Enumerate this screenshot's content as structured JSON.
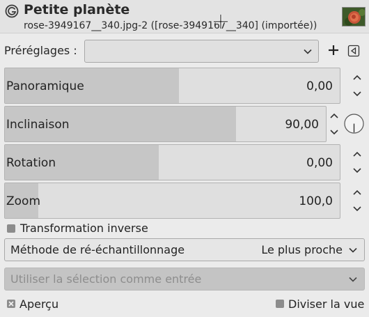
{
  "header": {
    "title": "Petite planète",
    "subtitle": "rose-3949167__340.jpg-2 ([rose-3949167__340] (importée))"
  },
  "presets": {
    "label": "Préréglages :",
    "value": "",
    "add_icon": "plus-icon",
    "menu_icon": "triangle-left-icon"
  },
  "sliders": [
    {
      "label": "Panoramique",
      "value": "0,00",
      "fill_fraction": 0.52
    },
    {
      "label": "Inclinaison",
      "value": "90,00",
      "fill_fraction": 0.72
    },
    {
      "label": "Rotation",
      "value": "0,00",
      "fill_fraction": 0.46
    },
    {
      "label": "Zoom",
      "value": "100,0",
      "fill_fraction": 0.1
    }
  ],
  "inverse_transform": {
    "label": "Transformation inverse",
    "checked": false
  },
  "resampling": {
    "label": "Méthode de ré-échantillonnage",
    "value": "Le plus proche"
  },
  "use_selection": {
    "label": "Utiliser la sélection comme entrée",
    "enabled": false
  },
  "preview": {
    "label": "Aperçu",
    "checked": true
  },
  "split_view": {
    "label": "Diviser la vue",
    "checked": false
  },
  "colors": {
    "slider_fill": "#c6c6c6",
    "slider_bg": "#dfdfdf",
    "window_bg": "#ebebeb"
  }
}
